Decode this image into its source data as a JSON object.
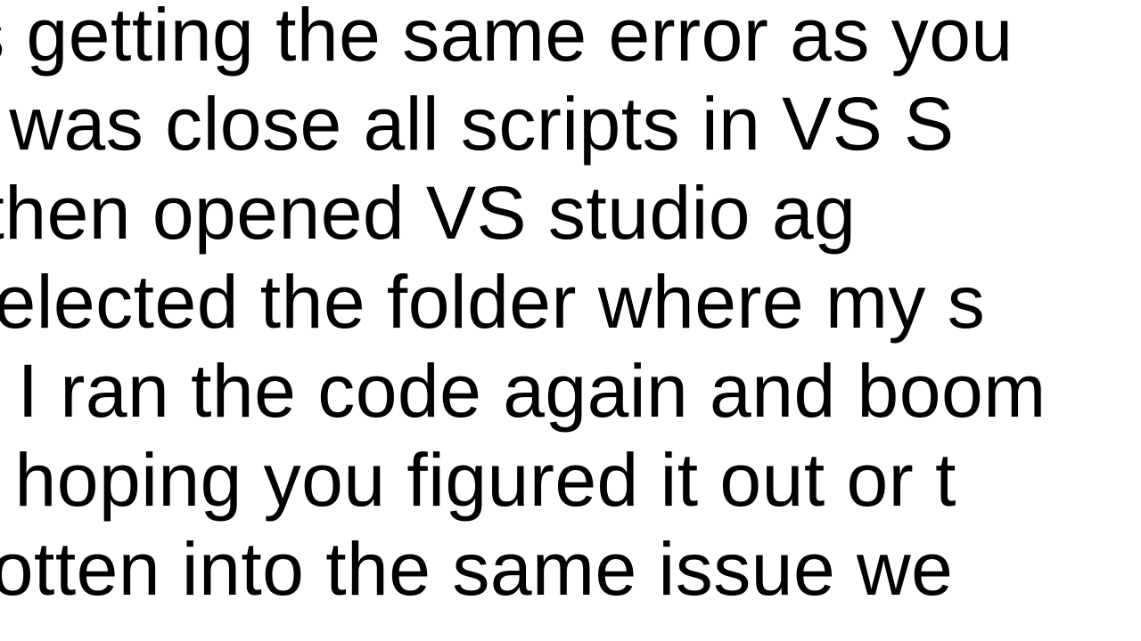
{
  "text": {
    "line1": "as getting the same error as you",
    "line2": "ve it was close all scripts in VS S",
    "line3": "ram. I then opened VS studio ag",
    "line4": "d selected the folder where my s",
    "line5": ". I ran the code again and boom",
    "line6": "e is hoping you figured it out or t",
    "line7": "ve gotten into the same issue we"
  }
}
